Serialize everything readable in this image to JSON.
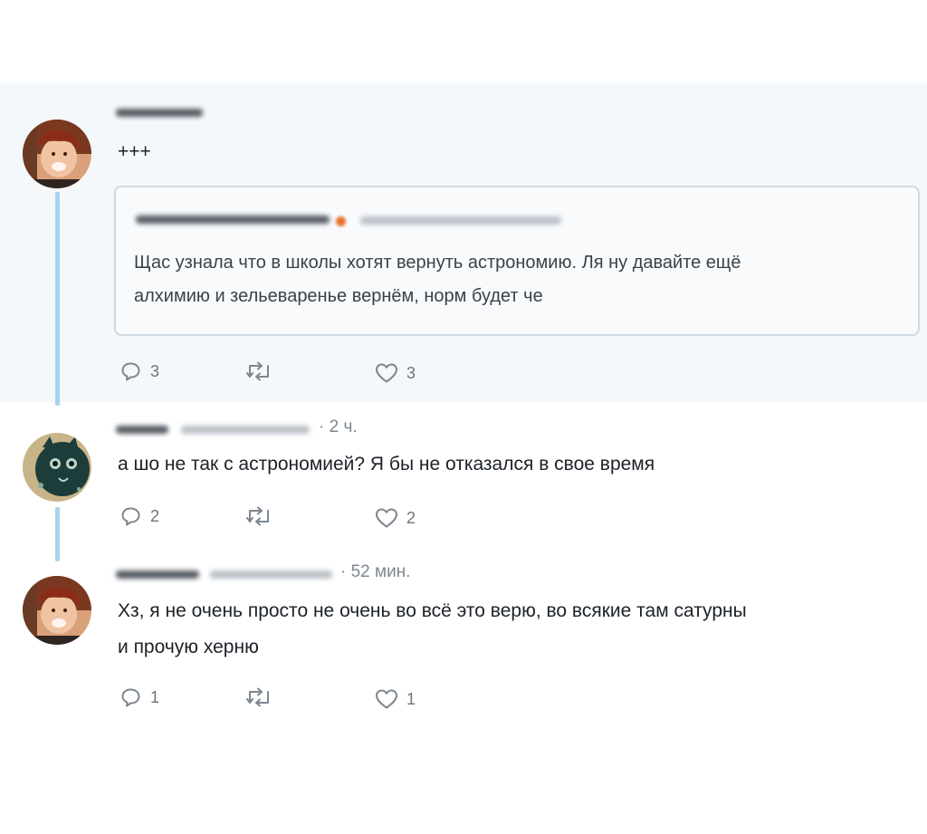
{
  "tweets": [
    {
      "text_lines": [
        "+++"
      ],
      "quote": {
        "lines": [
          "Щас узнала что в школы хотят вернуть астрономию. Ля ну давайте ещё",
          "алхимию и зельеваренье вернём, норм будет че"
        ]
      },
      "actions": {
        "replies": "3",
        "retweets": "",
        "likes": "3"
      }
    },
    {
      "time": "· 2 ч.",
      "text_lines": [
        "а шо не так  с астрономией? Я бы не отказался в свое время"
      ],
      "actions": {
        "replies": "2",
        "retweets": "",
        "likes": "2"
      }
    },
    {
      "time": "· 52 мин.",
      "text_lines": [
        "Хз, я не очень просто не очень во всё это верю, во всякие там сатурны",
        "и прочую херню"
      ],
      "actions": {
        "replies": "1",
        "retweets": "",
        "likes": "1"
      }
    }
  ],
  "icons": {
    "reply": "speech-bubble-icon",
    "retweet": "retweet-arrows-icon",
    "like": "heart-icon"
  },
  "colors": {
    "thread_line": "#a7d4ec",
    "band_background": "#f4f8fb",
    "icon_gray": "#7d8790"
  }
}
